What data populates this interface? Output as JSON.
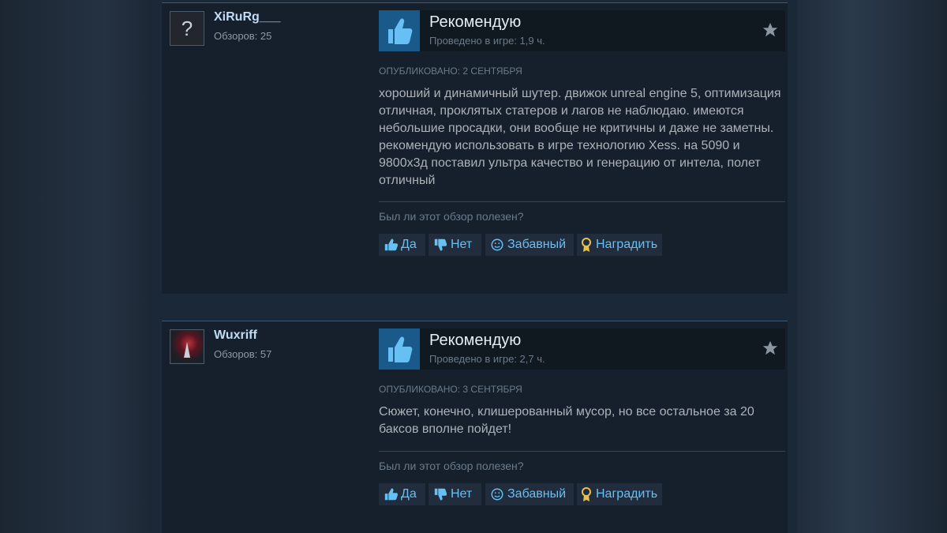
{
  "reviews": [
    {
      "username": "XiRuRg___",
      "reviews_count": "Обзоров: 25",
      "avatar": "question-mark-avatar",
      "verdict": "Рекомендую",
      "playtime": "Проведено в игре: 1,9 ч.",
      "posted": "ОПУБЛИКОВАНО: 2 СЕНТЯБРЯ",
      "text": "хороший и динамичный шутер. движок unreal engine 5, оптимизация отличная, проклятых статеров и лагов не наблюдаю. имеются небольшие просадки, они вообще не критичны и даже не заметны. рекомендую использовать в игре технологию Xess. на 5090 и 9800x3д поставил ультра качество и генерацию от интела, полет отличный",
      "helpful_question": "Был ли этот обзор полезен?",
      "buttons": {
        "yes": "Да",
        "no": "Нет",
        "funny": "Забавный",
        "award": "Наградить"
      }
    },
    {
      "username": "Wuxriff",
      "reviews_count": "Обзоров: 57",
      "avatar": "character-avatar",
      "verdict": "Рекомендую",
      "playtime": "Проведено в игре: 2,7 ч.",
      "posted": "ОПУБЛИКОВАНО: 3 СЕНТЯБРЯ",
      "text": "Сюжет, конечно, клишерованный мусор, но все остальное за 20 баксов вполне пойдет!",
      "helpful_question": "Был ли этот обзор полезен?",
      "buttons": {
        "yes": "Да",
        "no": "Нет",
        "funny": "Забавный",
        "award": "Наградить"
      }
    }
  ],
  "colors": {
    "accent_link": "#66c0f4",
    "username": "#c1dbf4",
    "recommend_box": "#1a5a8a"
  }
}
